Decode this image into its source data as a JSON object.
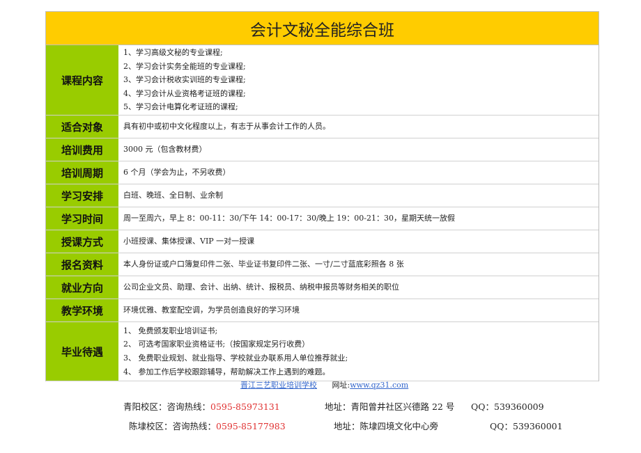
{
  "title": "会计文秘全能综合班",
  "rows": [
    {
      "label": "课程内容",
      "lines": [
        "1、学习高级文秘的专业课程;",
        "2、学习会计实务全能班的专业课程;",
        "3、学习会计税收实训班的专业课程;",
        "4、学习会计从业资格考证班的课程;",
        "5、学习会计电算化考证班的课程;"
      ]
    },
    {
      "label": "适合对象",
      "lines": [
        "具有初中或初中文化程度以上，有志于从事会计工作的人员。"
      ]
    },
    {
      "label": "培训费用",
      "lines": [
        "3000 元（包含教材费）"
      ]
    },
    {
      "label": "培训周期",
      "lines": [
        "6 个月（学会为止，不另收费）"
      ]
    },
    {
      "label": "学习安排",
      "lines": [
        "白班、晚班、全日制、业余制"
      ]
    },
    {
      "label": "学习时间",
      "lines": [
        "周一至周六，早上 8：00-11：30/下午 14：00-17：30/晚上 19：00-21：30，星期天统一放假"
      ]
    },
    {
      "label": "授课方式",
      "lines": [
        "小班授课、集体授课、VIP 一对一授课"
      ]
    },
    {
      "label": "报名资料",
      "lines": [
        "本人身份证或户口簿复印件二张、毕业证书复印件二张、一寸/二寸蓝底彩照各 8 张"
      ]
    },
    {
      "label": "就业方向",
      "lines": [
        "公司企业文员、助理、会计、出纳、统计、报税员、纳税申报员等财务相关的职位"
      ]
    },
    {
      "label": "教学环境",
      "lines": [
        "环境优雅、教室配空调，为学员创造良好的学习环境"
      ]
    },
    {
      "label": "毕业待遇",
      "lines": [
        "1、 免费颁发职业培训证书;",
        "2、 可选考国家职业资格证书;（按国家规定另行收费）",
        "3、 免费职业规划、就业指导、学校就业办联系用人单位推荐就业;",
        "4、 参加工作后学校跟踪辅导，帮助解决工作上遇到的难题。"
      ]
    }
  ],
  "footer": {
    "school": "晋江三艺职业培训学校",
    "website_label": "网址:",
    "website": "www.qz31.com"
  },
  "campuses": [
    {
      "name": "青阳校区：咨询热线：",
      "phone": "0595-85973131",
      "address": "地址：青阳曾井社区兴德路 22 号",
      "qq": "QQ：539360009"
    },
    {
      "name": "陈埭校区：咨询热线：",
      "phone": "0595-85177983",
      "address": "地址：陈埭四境文化中心旁",
      "qq": "QQ：539360001"
    }
  ]
}
